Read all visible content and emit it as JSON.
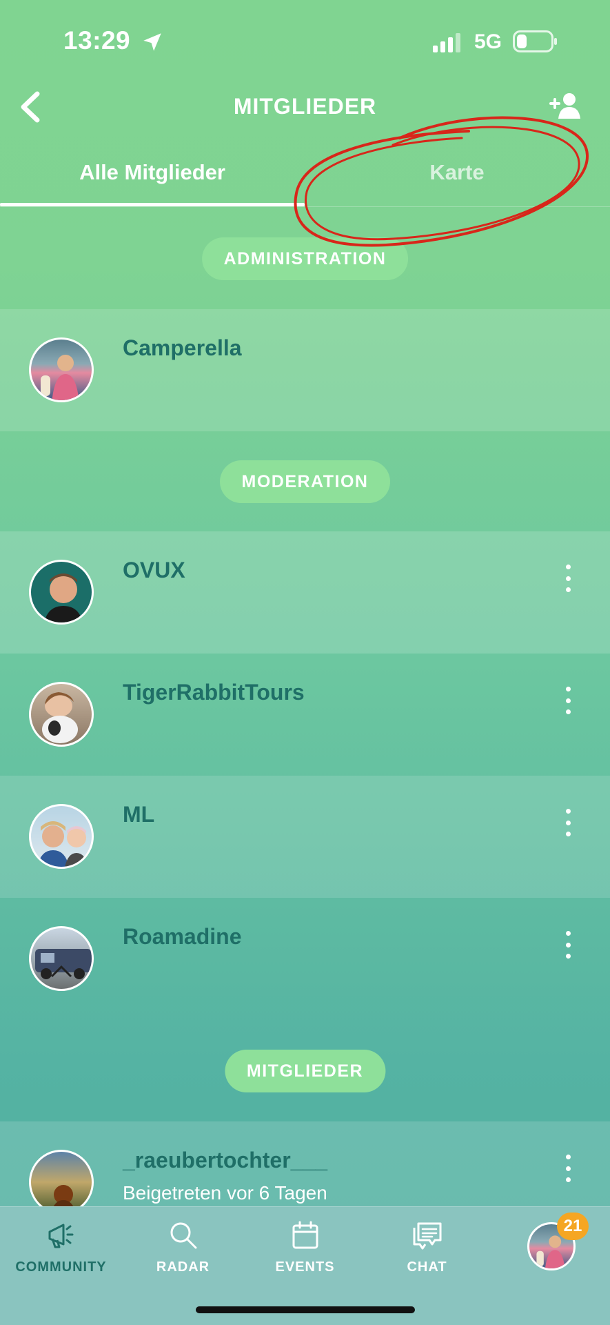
{
  "status_bar": {
    "time": "13:29",
    "network": "5G",
    "location_icon": "location-arrow-icon",
    "signal_icon": "signal-bars-icon",
    "battery_icon": "battery-low-icon"
  },
  "header": {
    "title": "MITGLIEDER",
    "back_icon": "chevron-left-icon",
    "add_icon": "add-member-icon"
  },
  "tabs": [
    {
      "label": "Alle Mitglieder",
      "active": true
    },
    {
      "label": "Karte",
      "active": false
    }
  ],
  "sections": {
    "administration": {
      "label": "ADMINISTRATION",
      "members": [
        {
          "name": "Camperella"
        }
      ]
    },
    "moderation": {
      "label": "MODERATION",
      "members": [
        {
          "name": "OVUX"
        },
        {
          "name": "TigerRabbitTours"
        },
        {
          "name": "ML"
        },
        {
          "name": "Roamadine"
        }
      ]
    },
    "members": {
      "label": "MITGLIEDER",
      "members": [
        {
          "name": "_raeubertochter___",
          "subtitle": "Beigetreten vor 6 Tagen"
        }
      ]
    }
  },
  "bottom_nav": {
    "items": [
      {
        "label": "COMMUNITY",
        "icon": "megaphone-icon",
        "active": true
      },
      {
        "label": "RADAR",
        "icon": "search-icon",
        "active": false
      },
      {
        "label": "EVENTS",
        "icon": "calendar-icon",
        "active": false
      },
      {
        "label": "CHAT",
        "icon": "chat-icon",
        "active": false
      }
    ],
    "profile_badge": "21"
  },
  "colors": {
    "accent_text": "#1f6f67",
    "pill": "#8ee09a",
    "badge": "#f5a623",
    "annotation": "#d8261a"
  }
}
